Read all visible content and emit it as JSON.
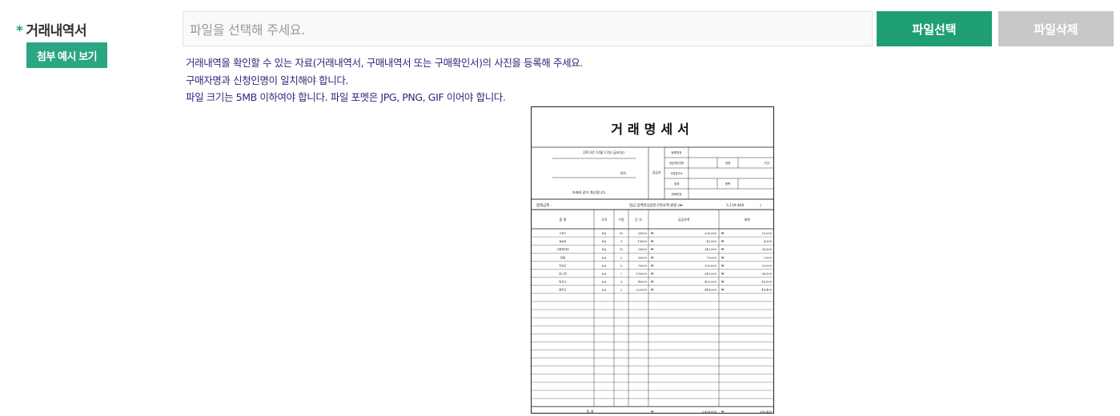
{
  "field": {
    "required_mark": "*",
    "label": "거래내역서",
    "example_button": "첨부 예시 보기"
  },
  "upload": {
    "placeholder": "파일을 선택해 주세요.",
    "select_button": "파일선택",
    "delete_button": "파일삭제"
  },
  "help_lines": [
    "거래내역을 확인할 수 있는 자료(거래내역서, 구매내역서 또는 구매확인서)의 사진을 등록해 주세요.",
    "구매자명과 신청인명이 일치해야 합니다.",
    "파일 크기는 5MB 이하여야 합니다. 파일 포멧은 JPG, PNG, GIF 이어야 합니다."
  ],
  "document": {
    "title": "거래명세서",
    "date": "2013년 12월 13일 (금요일)",
    "recipient_suffix": "귀하",
    "notice": "아래와 같이 계산합니다.",
    "supplier_label": "공급자",
    "supplier_fields": [
      "등록번호",
      "상호(법인명)",
      "성명",
      "(인)",
      "사업장주소",
      "업태",
      "종목",
      "전화번호"
    ],
    "total_label": "합계금액 :",
    "total_text": "일금 삼백일십삼만구천사백 원정 (₩",
    "total_amount": "3,139,400",
    "total_close": ")",
    "headers": [
      "품 명",
      "규격",
      "수량",
      "단 가",
      "공급가액",
      "세액"
    ],
    "rows": [
      [
        "CPU",
        "EA",
        "10",
        "25000",
        "₩",
        "250,000",
        "₩",
        "25,000"
      ],
      [
        "RAM",
        "EA",
        "3",
        "15000",
        "₩",
        "45,000",
        "₩",
        "4,500"
      ],
      [
        "그래픽카드",
        "EA",
        "15",
        "23000",
        "₩",
        "345,000",
        "₩",
        "34,500"
      ],
      [
        "파워",
        "EA",
        "2",
        "35000",
        "₩",
        "70,000",
        "₩",
        "7,000"
      ],
      [
        "키보드",
        "EA",
        "5",
        "70000",
        "₩",
        "350,000",
        "₩",
        "35,000"
      ],
      [
        "모니터",
        "EA",
        "7",
        "135000",
        "₩",
        "945,000",
        "₩",
        "94,500"
      ],
      [
        "마우스",
        "EA",
        "9",
        "45000",
        "₩",
        "405,000",
        "₩",
        "40,500"
      ],
      [
        "랜카드",
        "EA",
        "2",
        "222000",
        "₩",
        "444,000",
        "₩",
        "44,400"
      ]
    ],
    "footer_label": "합 계",
    "footer_currency": "₩",
    "footer_supply": "2,854,000",
    "footer_tax": "285,400"
  }
}
